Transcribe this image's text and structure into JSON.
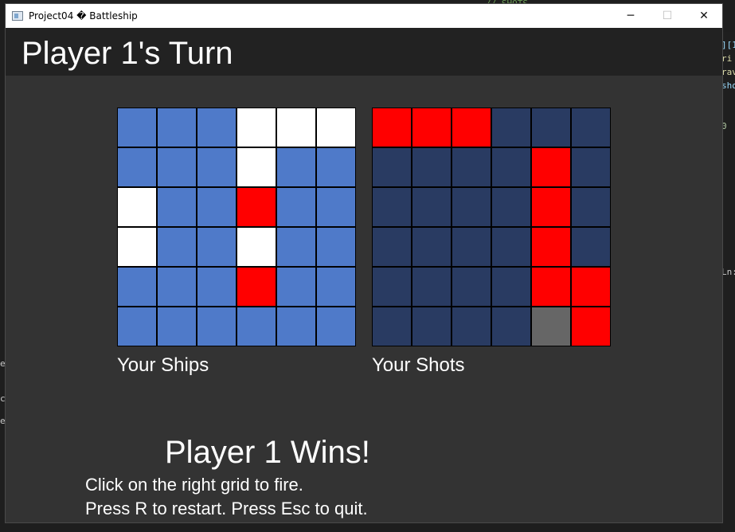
{
  "window": {
    "title": "Project04 � Battleship",
    "controls": {
      "minimize": "─",
      "maximize": "☐",
      "close": "✕"
    }
  },
  "background": {
    "top_fragment": "// SHOTS",
    "right_lines": [
      "][1",
      "ri",
      "rav",
      "sho",
      "",
      "",
      "0"
    ],
    "right_ln": "Ln:",
    "left_fragments": [
      "ei",
      "c",
      "ex"
    ]
  },
  "game": {
    "turn_title": "Player 1's Turn",
    "ships_label": "Your Ships",
    "shots_label": "Your Shots",
    "winner_text": "Player 1 Wins!",
    "instruction_fire": "Click on the right grid to fire.",
    "instruction_keys": "Press R to restart. Press Esc to quit."
  },
  "colors": {
    "ship": "#4f7ac9",
    "empty_own": "#ffffff",
    "hit": "#ff0000",
    "unknown": "#293b62",
    "miss": "#666666"
  },
  "ships_grid": [
    [
      "ship",
      "ship",
      "ship",
      "empty_own",
      "empty_own",
      "empty_own"
    ],
    [
      "ship",
      "ship",
      "ship",
      "empty_own",
      "ship",
      "ship"
    ],
    [
      "empty_own",
      "ship",
      "ship",
      "hit",
      "ship",
      "ship"
    ],
    [
      "empty_own",
      "ship",
      "ship",
      "empty_own",
      "ship",
      "ship"
    ],
    [
      "ship",
      "ship",
      "ship",
      "hit",
      "ship",
      "ship"
    ],
    [
      "ship",
      "ship",
      "ship",
      "ship",
      "ship",
      "ship"
    ]
  ],
  "shots_grid": [
    [
      "hit",
      "hit",
      "hit",
      "unknown",
      "unknown",
      "unknown"
    ],
    [
      "unknown",
      "unknown",
      "unknown",
      "unknown",
      "hit",
      "unknown"
    ],
    [
      "unknown",
      "unknown",
      "unknown",
      "unknown",
      "hit",
      "unknown"
    ],
    [
      "unknown",
      "unknown",
      "unknown",
      "unknown",
      "hit",
      "unknown"
    ],
    [
      "unknown",
      "unknown",
      "unknown",
      "unknown",
      "hit",
      "hit"
    ],
    [
      "unknown",
      "unknown",
      "unknown",
      "unknown",
      "miss",
      "hit"
    ]
  ]
}
